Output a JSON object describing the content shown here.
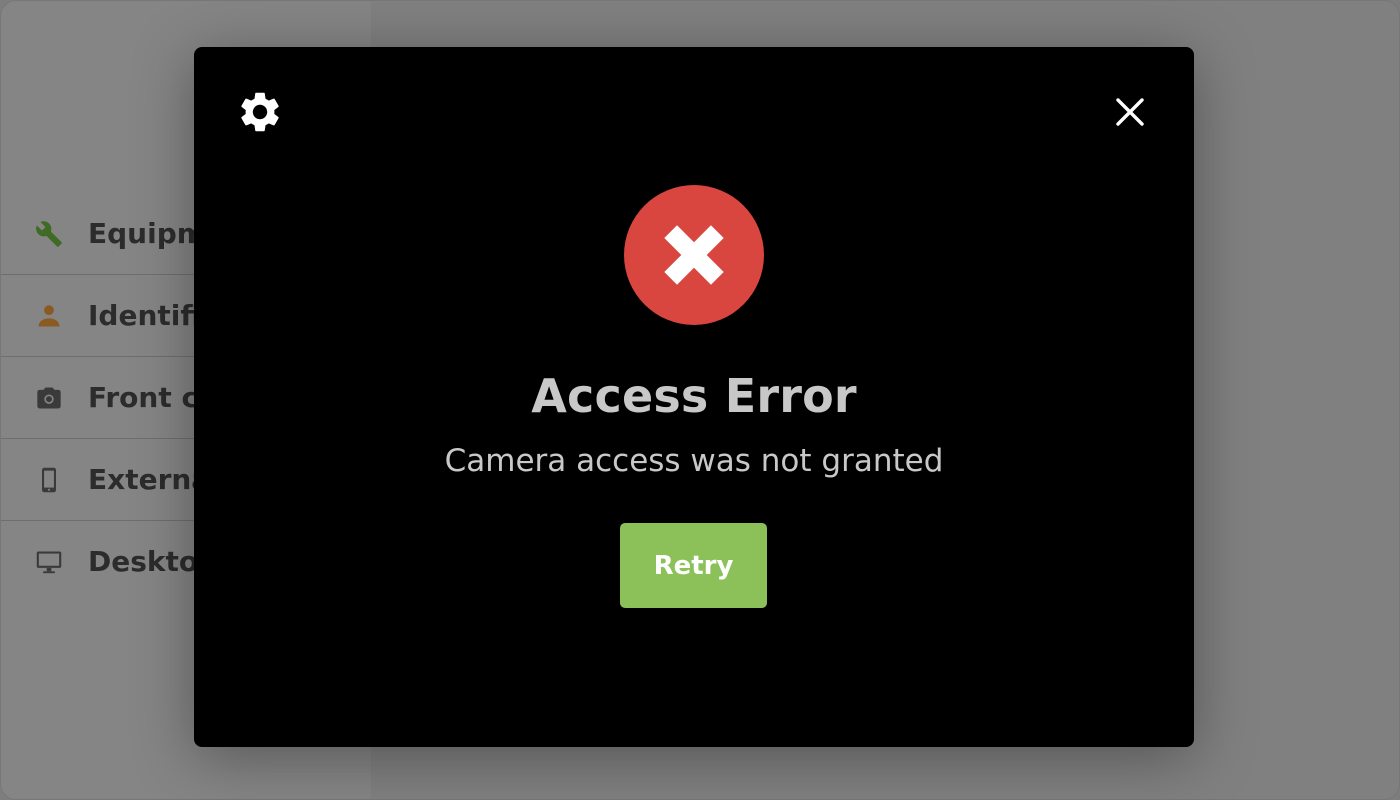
{
  "background": {
    "menu": [
      {
        "label": "Equipment",
        "icon": "wrench-icon",
        "icon_color": "#3f6b24"
      },
      {
        "label": "Identification",
        "icon": "person-icon",
        "icon_color": "#8a5a22"
      },
      {
        "label": "Front camera",
        "icon": "camera-icon",
        "icon_color": "#3a3a3a"
      },
      {
        "label": "External device",
        "icon": "phone-icon",
        "icon_color": "#3a3a3a"
      },
      {
        "label": "Desktop",
        "icon": "monitor-icon",
        "icon_color": "#3a3a3a"
      }
    ]
  },
  "modal": {
    "settings_icon": "gear-icon",
    "close_icon": "close-icon",
    "status_icon": "error-x-icon",
    "status_color": "#d9453f",
    "title": "Access Error",
    "message": "Camera access was not granted",
    "retry_label": "Retry",
    "retry_color": "#8cc15a"
  }
}
